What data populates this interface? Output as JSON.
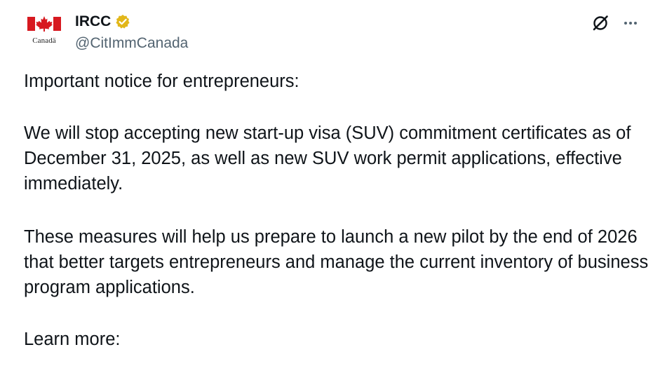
{
  "post": {
    "author": {
      "display_name": "IRCC",
      "handle": "@CitImmCanada",
      "verified": true,
      "verified_badge_color": "#e2b719",
      "avatar": {
        "icon": "government-of-canada-flag-logo",
        "wordmark": "Canadä",
        "flag_color": "#d71920"
      }
    },
    "actions": {
      "grok_icon": "grok-icon",
      "more_icon": "more-options-icon"
    },
    "text": {
      "paragraph_1": "Important notice for entrepreneurs:",
      "paragraph_2": "We will stop accepting new start-up visa (SUV) commitment certificates as of December 31, 2025, as well as new SUV work permit applications, effective immediately.",
      "paragraph_3": "These measures will help us prepare to launch a new pilot by the end of 2026 that better targets entrepreneurs and manage the current inventory of business program applications.",
      "paragraph_4": "Learn more:"
    }
  }
}
